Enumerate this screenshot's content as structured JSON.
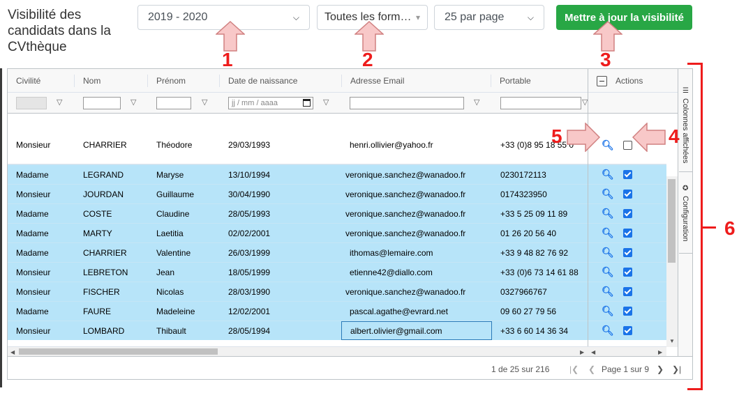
{
  "page": {
    "title": "Visibilité des candidats dans la CVthèque"
  },
  "toolbar": {
    "year_select": "2019 - 2020",
    "formation_select": "Toutes les form…",
    "per_page_select": "25 par page",
    "update_button": "Mettre à jour la visibilité"
  },
  "grid": {
    "columns": [
      "Civilité",
      "Nom",
      "Prénom",
      "Date de naissance",
      "Adresse Email",
      "Portable",
      "Actions"
    ],
    "date_placeholder": "jj / mm / aaaa",
    "first_row": {
      "civilite": "Monsieur",
      "nom": "CHARRIER",
      "prenom": "Théodore",
      "date": "29/03/1993",
      "email": "henri.ollivier@yahoo.fr",
      "portable": "+33 (0)8 95 18 55 0"
    },
    "rows": [
      {
        "civilite": "Madame",
        "nom": "LEGRAND",
        "prenom": "Maryse",
        "date": "13/10/1994",
        "email": "veronique.sanchez@wanadoo.fr",
        "portable": "0230172113"
      },
      {
        "civilite": "Monsieur",
        "nom": "JOURDAN",
        "prenom": "Guillaume",
        "date": "30/04/1990",
        "email": "veronique.sanchez@wanadoo.fr",
        "portable": "0174323950"
      },
      {
        "civilite": "Madame",
        "nom": "COSTE",
        "prenom": "Claudine",
        "date": "28/05/1993",
        "email": "veronique.sanchez@wanadoo.fr",
        "portable": "+33 5 25 09 11 89"
      },
      {
        "civilite": "Madame",
        "nom": "MARTY",
        "prenom": "Laetitia",
        "date": "02/02/2001",
        "email": "veronique.sanchez@wanadoo.fr",
        "portable": "01 26 20 56 40"
      },
      {
        "civilite": "Madame",
        "nom": "CHARRIER",
        "prenom": "Valentine",
        "date": "26/03/1999",
        "email": "ithomas@lemaire.com",
        "portable": "+33 9 48 82 76 92"
      },
      {
        "civilite": "Monsieur",
        "nom": "LEBRETON",
        "prenom": "Jean",
        "date": "18/05/1999",
        "email": "etienne42@diallo.com",
        "portable": "+33 (0)6 73 14 61 88"
      },
      {
        "civilite": "Monsieur",
        "nom": "FISCHER",
        "prenom": "Nicolas",
        "date": "28/03/1990",
        "email": "veronique.sanchez@wanadoo.fr",
        "portable": "0327966767"
      },
      {
        "civilite": "Madame",
        "nom": "FAURE",
        "prenom": "Madeleine",
        "date": "12/02/2001",
        "email": "pascal.agathe@evrard.net",
        "portable": "09 60 27 79 56"
      },
      {
        "civilite": "Monsieur",
        "nom": "LOMBARD",
        "prenom": "Thibault",
        "date": "28/05/1994",
        "email": "albert.olivier@gmail.com",
        "portable": "+33 6 60 14 36 34"
      }
    ]
  },
  "sidebar": {
    "columns_tab": "Colonnes affichées",
    "config_tab": "Configuration"
  },
  "footer": {
    "range": "1 de 25 sur 216",
    "page_info": "Page 1 sur 9"
  },
  "annotations": {
    "n1": "1",
    "n2": "2",
    "n3": "3",
    "n4": "4",
    "n5": "5",
    "n6": "6"
  },
  "colors": {
    "accent_green": "#28a745",
    "selected_row": "#b7e4f9",
    "annotation_red": "#ee1c1c",
    "arrow_fill": "#f8c8c8"
  }
}
